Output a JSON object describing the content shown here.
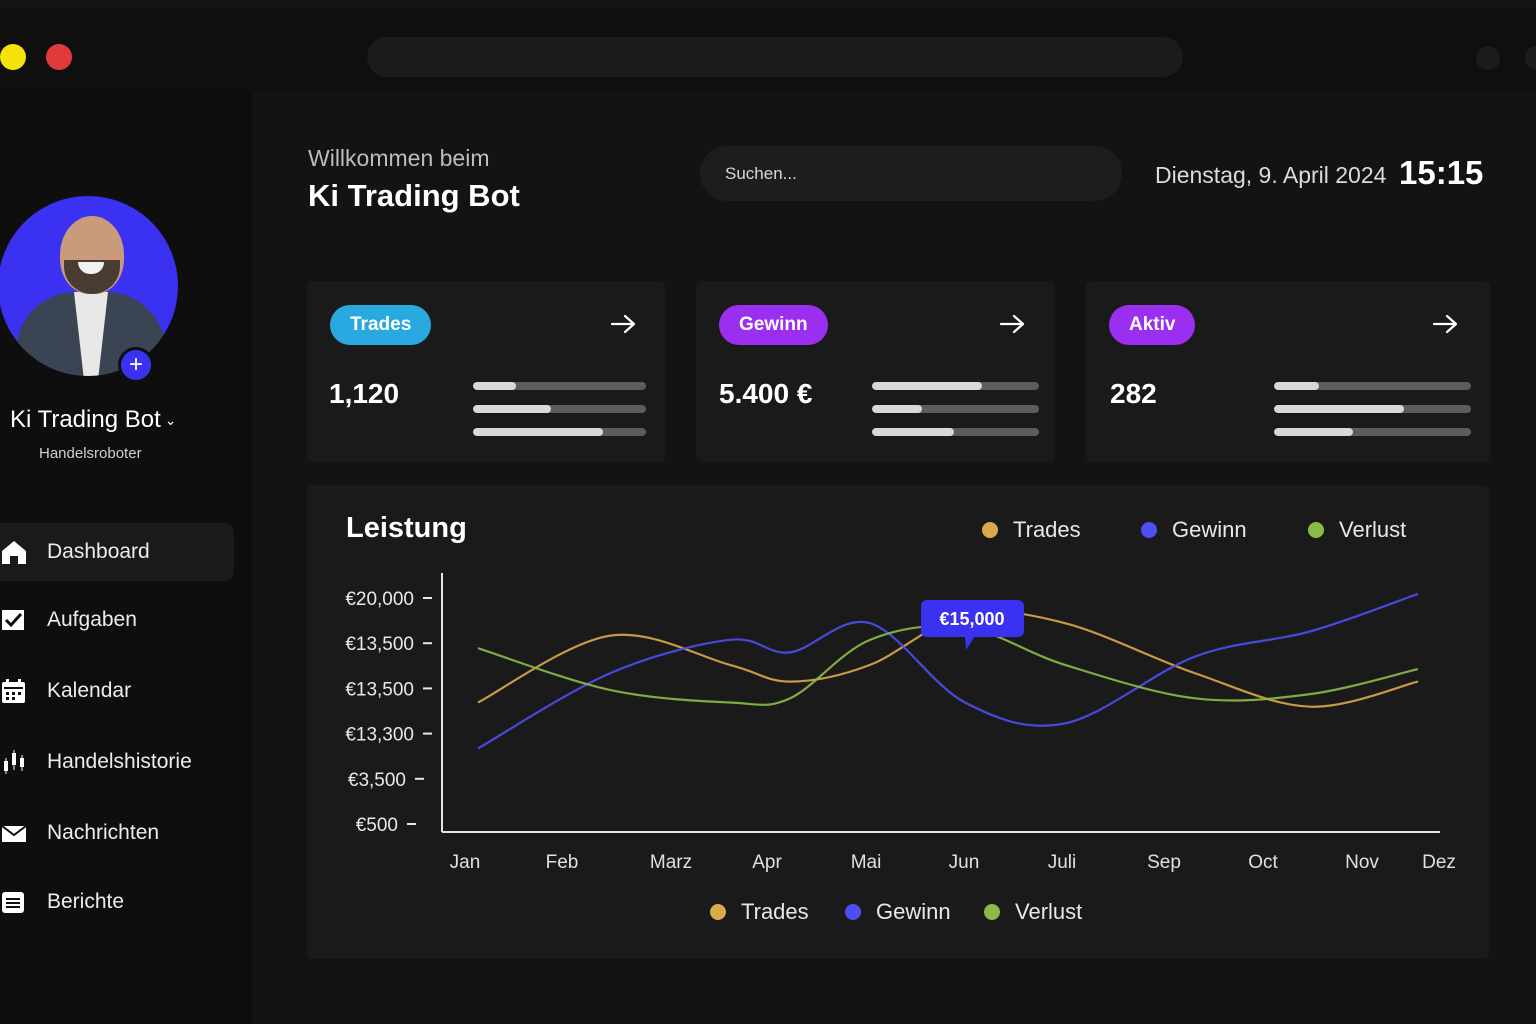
{
  "app": {
    "welcome": "Willkommen beim",
    "title": "Ki Trading Bot"
  },
  "search": {
    "placeholder": "Suchen..."
  },
  "header": {
    "date": "Dienstag, 9. April 2024",
    "time": "15:15"
  },
  "profile": {
    "name": "Ki Trading Bot",
    "role": "Handelsroboter"
  },
  "sidebar": {
    "items": [
      {
        "label": "Dashboard",
        "icon": "home-icon",
        "active": true
      },
      {
        "label": "Aufgaben",
        "icon": "checkbox-icon",
        "active": false
      },
      {
        "label": "Kalendar",
        "icon": "calendar-icon",
        "active": false
      },
      {
        "label": "Handelshistorie",
        "icon": "candlestick-icon",
        "active": false
      },
      {
        "label": "Nachrichten",
        "icon": "mail-icon",
        "active": false
      },
      {
        "label": "Berichte",
        "icon": "document-icon",
        "active": false
      }
    ]
  },
  "cards": [
    {
      "badge": "Trades",
      "color": "#29a9e0",
      "value": "1,120",
      "bars": [
        0.25,
        0.45,
        0.75
      ]
    },
    {
      "badge": "Gewinn",
      "color": "#9b2ff0",
      "value": "5.400 €",
      "bars": [
        0.66,
        0.3,
        0.49
      ]
    },
    {
      "badge": "Aktiv",
      "color": "#9b2ff0",
      "value": "282",
      "bars": [
        0.23,
        0.66,
        0.4
      ]
    }
  ],
  "chart_panel": {
    "title": "Leistung",
    "legend": [
      {
        "label": "Trades",
        "color": "#d9a94b"
      },
      {
        "label": "Gewinn",
        "color": "#4c4ff2"
      },
      {
        "label": "Verlust",
        "color": "#8bbb47"
      }
    ],
    "tooltip": "€15,000"
  },
  "chart_data": {
    "type": "line",
    "title": "Leistung",
    "y_tick_labels": [
      "€20,000",
      "€13,500",
      "€13,500",
      "€13,300",
      "€3,500",
      "€500"
    ],
    "categories": [
      "Jan",
      "Feb",
      "Marz",
      "Apr",
      "Mai",
      "Jun",
      "Juli",
      "Sep",
      "Oct",
      "Nov",
      "Dez"
    ],
    "series": [
      {
        "name": "Trades",
        "color": "#d9a94b",
        "values": [
          3.1,
          4.7,
          4.0,
          3.6,
          4.0,
          5.2,
          5.0,
          3.8,
          3.0,
          3.6
        ]
      },
      {
        "name": "Gewinn",
        "color": "#4c4ff2",
        "values": [
          2.0,
          3.8,
          4.6,
          4.3,
          5.0,
          3.1,
          2.6,
          4.2,
          4.8,
          5.7
        ]
      },
      {
        "name": "Verlust",
        "color": "#8bbb47",
        "values": [
          4.4,
          3.4,
          3.1,
          3.2,
          4.6,
          4.9,
          4.0,
          3.2,
          3.3,
          3.9
        ]
      }
    ],
    "highlight": {
      "series": "Gewinn",
      "category": "Jun",
      "label": "€15,000"
    },
    "grid": false,
    "legend_position": "top-right and bottom"
  }
}
